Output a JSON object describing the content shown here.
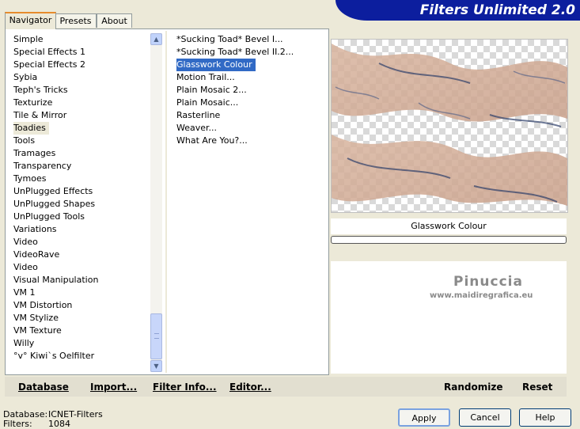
{
  "header": {
    "title": "Filters Unlimited 2.0"
  },
  "tabs": [
    {
      "label": "Navigator"
    },
    {
      "label": "Presets"
    },
    {
      "label": "About"
    }
  ],
  "categories": [
    "Simple",
    "Special Effects 1",
    "Special Effects 2",
    "Sybia",
    "Teph's Tricks",
    "Texturize",
    "Tile & Mirror",
    "Toadies",
    "Tools",
    "Tramages",
    "Transparency",
    "Tymoes",
    "UnPlugged Effects",
    "UnPlugged Shapes",
    "UnPlugged Tools",
    "Variations",
    "Video",
    "VideoRave",
    "Video",
    "Visual Manipulation",
    "VM 1",
    "VM Distortion",
    "VM Stylize",
    "VM Texture",
    "Willy",
    "°v° Kiwi`s Oelfilter"
  ],
  "selected_category": "Toadies",
  "filters": [
    "*Sucking Toad*  Bevel I...",
    "*Sucking Toad*  Bevel II.2...",
    "Glasswork Colour",
    "Motion Trail...",
    "Plain Mosaic 2...",
    "Plain Mosaic...",
    "Rasterline",
    "Weaver...",
    "What Are You?..."
  ],
  "selected_filter": "Glasswork Colour",
  "preview": {
    "filter_name": "Glasswork Colour"
  },
  "watermark": {
    "name": "Pinuccia",
    "url": "www.maidiregrafica.eu"
  },
  "buttons": {
    "database": "Database",
    "import": "Import...",
    "filter_info": "Filter Info...",
    "editor": "Editor...",
    "randomize": "Randomize",
    "reset": "Reset",
    "apply": "Apply",
    "cancel": "Cancel",
    "help": "Help"
  },
  "status": {
    "database_label": "Database:",
    "database_value": "ICNET-Filters",
    "filters_label": "Filters:",
    "filters_value": "1084"
  },
  "colors": {
    "header_bg": "#0C1E9E",
    "selection": "#316AC5"
  }
}
